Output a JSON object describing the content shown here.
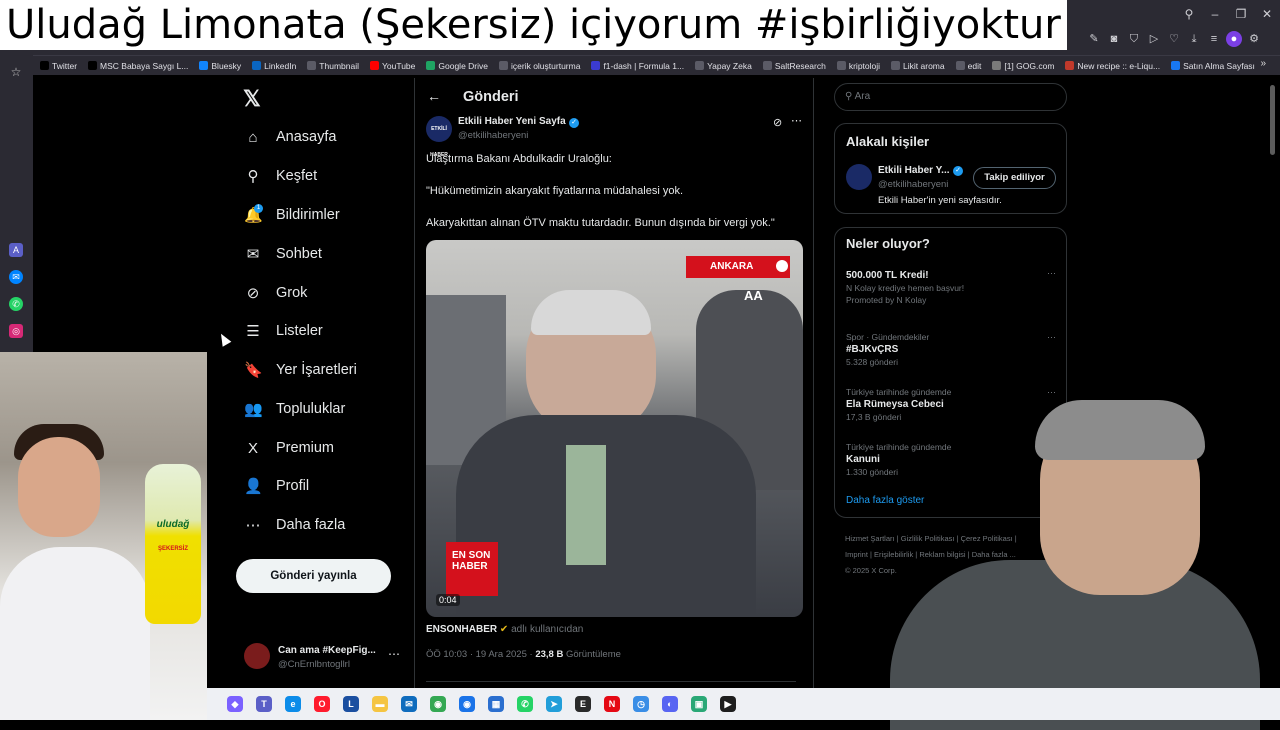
{
  "overlay": {
    "title": "Uludağ Limonata (Şekersiz) içiyorum #işbirliğiyoktur"
  },
  "bookmarks": [
    {
      "label": "Twitter",
      "icon": "x-icon",
      "color": "#000000"
    },
    {
      "label": "MSC Babaya Saygı L...",
      "icon": "x-icon",
      "color": "#000000"
    },
    {
      "label": "Bluesky",
      "icon": "butterfly-icon",
      "color": "#1185fe"
    },
    {
      "label": "LinkedIn",
      "icon": "linkedin-icon",
      "color": "#0a66c2"
    },
    {
      "label": "Thumbnail",
      "icon": "folder-icon",
      "color": "#5b5b66"
    },
    {
      "label": "YouTube",
      "icon": "youtube-icon",
      "color": "#ff0000"
    },
    {
      "label": "Google Drive",
      "icon": "drive-icon",
      "color": "#1fa463"
    },
    {
      "label": "içerik oluşturturma",
      "icon": "folder-icon",
      "color": "#5b5b66"
    },
    {
      "label": "f1-dash | Formula 1...",
      "icon": "f1-icon",
      "color": "#3b3bd1"
    },
    {
      "label": "Yapay Zeka",
      "icon": "folder-icon",
      "color": "#5b5b66"
    },
    {
      "label": "SaltResearch",
      "icon": "folder-icon",
      "color": "#5b5b66"
    },
    {
      "label": "kriptoloji",
      "icon": "folder-icon",
      "color": "#5b5b66"
    },
    {
      "label": "Likit aroma",
      "icon": "folder-icon",
      "color": "#5b5b66"
    },
    {
      "label": "edit",
      "icon": "folder-icon",
      "color": "#5b5b66"
    },
    {
      "label": "[1] GOG.com",
      "icon": "gog-icon",
      "color": "#7a7a7a"
    },
    {
      "label": "New recipe :: e-Liqu...",
      "icon": "recipe-icon",
      "color": "#c0392b"
    },
    {
      "label": "Satın Alma Sayfası",
      "icon": "meta-icon",
      "color": "#1877f2"
    }
  ],
  "nav": {
    "items": [
      {
        "label": "Anasayfa",
        "icon": "home-icon",
        "glyph": "⌂"
      },
      {
        "label": "Keşfet",
        "icon": "search-icon",
        "glyph": "⚲"
      },
      {
        "label": "Bildirimler",
        "icon": "bell-icon",
        "glyph": "🔔"
      },
      {
        "label": "Sohbet",
        "icon": "mail-icon",
        "glyph": "✉"
      },
      {
        "label": "Grok",
        "icon": "grok-icon",
        "glyph": "⊘"
      },
      {
        "label": "Listeler",
        "icon": "list-icon",
        "glyph": "☰"
      },
      {
        "label": "Yer İşaretleri",
        "icon": "bookmark-icon",
        "glyph": "🔖"
      },
      {
        "label": "Topluluklar",
        "icon": "people-icon",
        "glyph": "👥"
      },
      {
        "label": "Premium",
        "icon": "x-icon",
        "glyph": "X"
      },
      {
        "label": "Profil",
        "icon": "person-icon",
        "glyph": "👤"
      },
      {
        "label": "Daha fazla",
        "icon": "more-icon",
        "glyph": "⋯"
      }
    ],
    "notif_count": "1",
    "post_button": "Gönderi yayınla",
    "account": {
      "name": "Can ama #KeepFig...",
      "handle": "@CnErnlbntogllrl"
    }
  },
  "header": {
    "title": "Gönderi"
  },
  "post": {
    "author_name": "Etkili Haber Yeni Sayfa",
    "author_handle": "@etkilihaberyeni",
    "avatar_text": "ETKİLİ HABER",
    "lines": [
      "Ulaştırma Bakanı Abdulkadir Uraloğlu:",
      "\"Hükümetimizin akaryakıt fiyatlarına müdahalesi yok.",
      "Akaryakıttan alınan ÖTV maktu tutardadır. Bunun dışında bir vergi yok.\""
    ],
    "video": {
      "location_tag": "ANKARA",
      "agency": "AA",
      "logo_text": "EN SON HABER",
      "duration": "0:04"
    },
    "source": {
      "name": "ENSONHABER",
      "suffix": "adlı kullanıcıdan"
    },
    "meta": {
      "time": "ÖÖ 10:03 · 19 Ara 2025 · ",
      "views": "23,8 B",
      "views_label": " Görüntüleme"
    }
  },
  "search": {
    "placeholder": "Ara"
  },
  "related": {
    "heading": "Alakalı kişiler",
    "name": "Etkili Haber Y...",
    "handle": "@etkilihaberyeni",
    "bio": "Etkili Haber'in yeni sayfasıdır.",
    "follow_label": "Takip ediliyor"
  },
  "trends": {
    "heading": "Neler oluyor?",
    "items": [
      {
        "category": "",
        "title": "500.000 TL Kredi!",
        "count": "N Kolay krediye hemen başvur!",
        "promo": "Promoted by N Kolay"
      },
      {
        "category": "Spor · Gündemdekiler",
        "title": "#BJKvÇRS",
        "count": "5.328 gönderi",
        "promo": ""
      },
      {
        "category": "Türkiye tarihinde gündemde",
        "title": "Ela Rümeysa Cebeci",
        "count": "17,3 B gönderi",
        "promo": ""
      },
      {
        "category": "Türkiye tarihinde gündemde",
        "title": "Kanuni",
        "count": "1.330 gönderi",
        "promo": ""
      }
    ],
    "show_more": "Daha fazla göster"
  },
  "footer": {
    "line1": "Hizmet Şartları  |  Gizlilik Politikası  |  Çerez Politikası  |",
    "line2": "Imprint  |  Erişilebilirlik  |  Reklam bilgisi  |  Daha fazla ...",
    "line3": "© 2025 X Corp."
  },
  "bottle": {
    "brand": "uludağ",
    "variant": "ŞEKERSİZ"
  },
  "taskbar": [
    {
      "icon": "copilot-icon",
      "color": "#7b61ff",
      "glyph": "◆"
    },
    {
      "icon": "teams-icon",
      "color": "#5b5fc7",
      "glyph": "T"
    },
    {
      "icon": "edge-icon",
      "color": "#0c8ce9",
      "glyph": "e"
    },
    {
      "icon": "opera-icon",
      "color": "#ff1b2d",
      "glyph": "O"
    },
    {
      "icon": "lens-icon",
      "color": "#1b4fa0",
      "glyph": "L"
    },
    {
      "icon": "explorer-icon",
      "color": "#f5c542",
      "glyph": "▬"
    },
    {
      "icon": "outlook-icon",
      "color": "#0f6cbd",
      "glyph": "✉"
    },
    {
      "icon": "chrome-icon",
      "color": "#34a853",
      "glyph": "◉"
    },
    {
      "icon": "chrome-dev-icon",
      "color": "#1a73e8",
      "glyph": "◉"
    },
    {
      "icon": "store-icon",
      "color": "#2b6fcf",
      "glyph": "▦"
    },
    {
      "icon": "whatsapp-icon",
      "color": "#25d366",
      "glyph": "✆"
    },
    {
      "icon": "telegram-icon",
      "color": "#229ed9",
      "glyph": "➤"
    },
    {
      "icon": "epic-icon",
      "color": "#2a2a2a",
      "glyph": "E"
    },
    {
      "icon": "netflix-icon",
      "color": "#e50914",
      "glyph": "N"
    },
    {
      "icon": "clock-icon",
      "color": "#3a8ee6",
      "glyph": "◷"
    },
    {
      "icon": "discord-icon",
      "color": "#5865f2",
      "glyph": "◐"
    },
    {
      "icon": "app-icon",
      "color": "#2aa876",
      "glyph": "▣"
    },
    {
      "icon": "terminal-icon",
      "color": "#1e1e1e",
      "glyph": "▶"
    }
  ]
}
